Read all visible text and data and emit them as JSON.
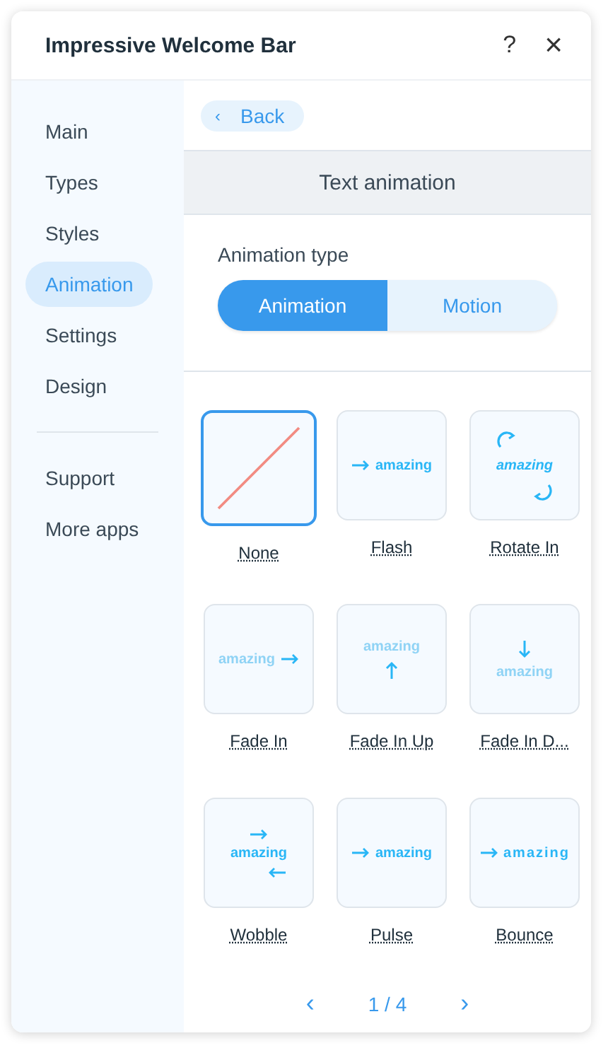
{
  "window": {
    "title": "Impressive Welcome Bar",
    "help": "?",
    "close": "×"
  },
  "sidebar": {
    "items": [
      {
        "label": "Main",
        "selected": false
      },
      {
        "label": "Types",
        "selected": false
      },
      {
        "label": "Styles",
        "selected": false
      },
      {
        "label": "Animation",
        "selected": true
      },
      {
        "label": "Settings",
        "selected": false
      },
      {
        "label": "Design",
        "selected": false
      }
    ],
    "extra_items": [
      {
        "label": "Support",
        "selected": false
      },
      {
        "label": "More apps",
        "selected": false
      }
    ]
  },
  "back_button": {
    "icon": "‹",
    "label": "Back"
  },
  "section_title": "Text animation",
  "animation_type": {
    "label": "Animation type",
    "options": [
      {
        "label": "Animation",
        "selected": true
      },
      {
        "label": "Motion",
        "selected": false
      }
    ]
  },
  "effects": [
    {
      "kind": "none",
      "label": "None",
      "selected": true
    },
    {
      "kind": "flash",
      "label": "Flash",
      "sample": "amazing",
      "selected": false
    },
    {
      "kind": "rotate",
      "label": "Rotate In",
      "sample": "amazing",
      "selected": false
    },
    {
      "kind": "fade",
      "label": "Fade In",
      "sample": "amazing",
      "selected": false
    },
    {
      "kind": "fadeup",
      "label": "Fade In Up",
      "sample": "amazing",
      "selected": false
    },
    {
      "kind": "fadedown",
      "label": "Fade In D...",
      "sample": "amazing",
      "selected": false
    },
    {
      "kind": "wobble",
      "label": "Wobble",
      "sample": "amazing",
      "selected": false
    },
    {
      "kind": "pulse",
      "label": "Pulse",
      "sample": "amazing",
      "selected": false
    },
    {
      "kind": "bounce",
      "label": "Bounce",
      "sample": "amazing",
      "selected": false
    }
  ],
  "pagination": {
    "prev": "‹",
    "page": "1 / 4",
    "next": "›"
  }
}
